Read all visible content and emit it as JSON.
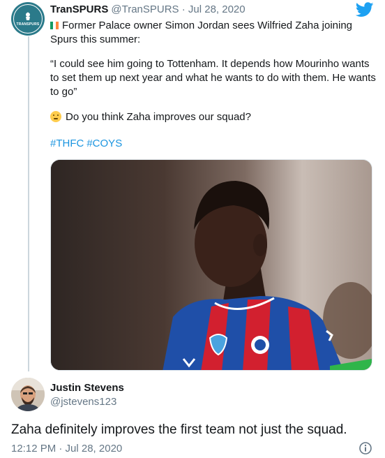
{
  "original_tweet": {
    "display_name": "TranSPURS",
    "handle_and_date": "@TranSPURS · Jul 28, 2020",
    "avatar_text": "TRANSPURS",
    "text_line1": "Former Palace owner Simon Jordan sees Wilfried Zaha joining Spurs this summer:",
    "quote": "“I could see him going to Tottenham. It depends how Mourinho wants to set them up next year and what he wants to do with them. He wants to go”",
    "question": "Do you think Zaha improves our squad?",
    "hashtags": [
      "#THFC",
      "#COYS"
    ],
    "flag_icon": "ireland-flag-icon",
    "emoji_icon": "thinking-face-emoji",
    "brand_icon": "twitter-bird-icon",
    "link_color": "#1b95e0",
    "brand_color": "#1da1f2"
  },
  "reply": {
    "display_name": "Justin Stevens",
    "handle": "@jstevens123",
    "text": "Zaha definitely improves the first team not just the squad.",
    "timestamp": "12:12 PM · Jul 28, 2020",
    "info_icon": "info-icon"
  }
}
